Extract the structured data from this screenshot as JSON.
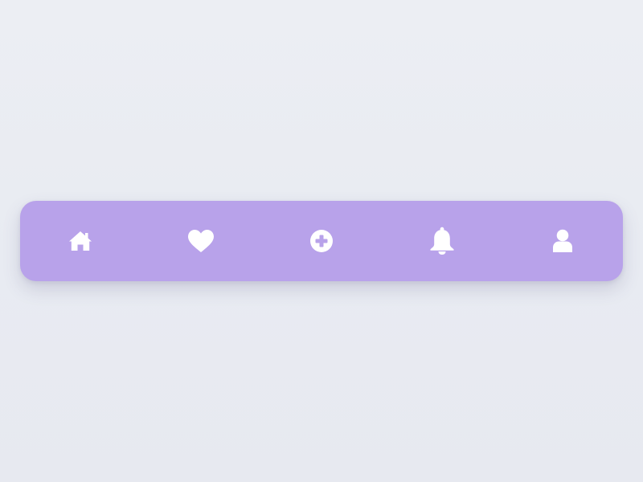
{
  "nav_bar": {
    "background_color": "#b8a2ea",
    "icon_color": "#ffffff",
    "items": [
      {
        "icon": "home-icon"
      },
      {
        "icon": "heart-icon"
      },
      {
        "icon": "add-circle-icon"
      },
      {
        "icon": "bell-icon"
      },
      {
        "icon": "user-icon"
      }
    ]
  }
}
